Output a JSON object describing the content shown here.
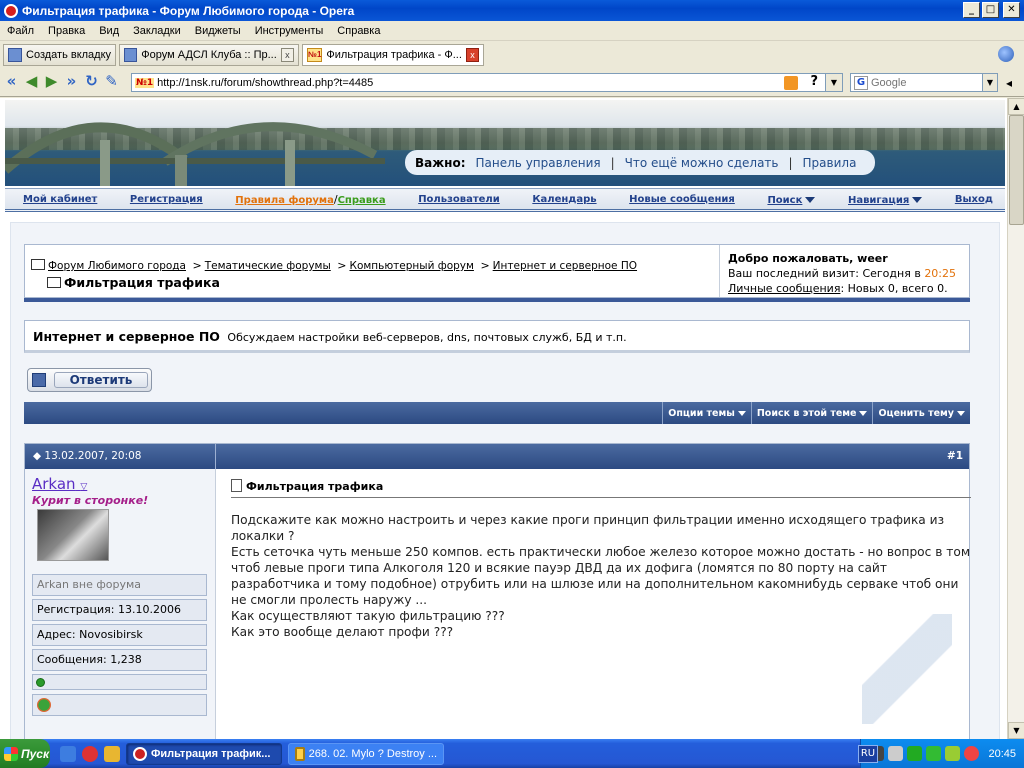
{
  "window": {
    "title": "Фильтрация трафика - Форум Любимого города - Opera",
    "controls": [
      "_",
      "□",
      "✕"
    ]
  },
  "menu": [
    "Файл",
    "Правка",
    "Вид",
    "Закладки",
    "Виджеты",
    "Инструменты",
    "Справка"
  ],
  "tabs": [
    {
      "label": "Создать вкладку"
    },
    {
      "label": "Форум АДСЛ Клуба :: Пр...",
      "close": "x"
    },
    {
      "label": "Фильтрация трафика - Ф...",
      "close": "x",
      "badge": "№1"
    }
  ],
  "address": {
    "badge": "№1",
    "url": "http://1nsk.ru/forum/showthread.php?t=4485",
    "help": "?",
    "search_placeholder": "Google",
    "search_badge": "G"
  },
  "forum": {
    "important": {
      "label": "Важно:",
      "links": [
        "Панель управления",
        "Что ещё можно сделать",
        "Правила"
      ]
    },
    "nav": {
      "cabinet": "Мой кабинет",
      "register": "Регистрация",
      "rules": "Правила форума",
      "slash": "/",
      "help": "Справка",
      "users": "Пользователи",
      "calendar": "Календарь",
      "new_posts": "Новые сообщения",
      "search": "Поиск",
      "navigation": "Навигация",
      "logout": "Выход"
    },
    "breadcrumb": {
      "items": [
        "Форум Любимого города",
        "Тематические форумы",
        "Компьютерный форум",
        "Интернет и серверное ПО"
      ],
      "separator": ">",
      "current": "Фильтрация трафика"
    },
    "welcome": {
      "greeting": "Добро пожаловать, weer",
      "last_visit_label": "Ваш последний визит: Сегодня в",
      "last_visit_time": "20:25",
      "pm_link": "Личные сообщения",
      "pm_status": ": Новых 0, всего 0."
    },
    "forum_desc": {
      "name": "Интернет и серверное ПО",
      "desc": "Обсуждаем настройки веб-серверов, dns, почтовых служб, БД и т.п."
    },
    "reply_button": "Ответить",
    "thread_tools": [
      "Опции темы",
      "Поиск в этой теме",
      "Оценить тему"
    ],
    "post": {
      "date": "13.02.2007, 20:08",
      "number": "#1",
      "author": "Arkan",
      "user_title": "Курит в сторонке!",
      "status": "Arkan вне форума",
      "registration": "Регистрация: 13.10.2006",
      "address": "Адрес: Novosibirsk",
      "messages": "Сообщения: 1,238",
      "title": "Фильтрация трафика",
      "text": "Подскажите как можно настроить и через какие проги принцип фильтрации именно исходящего трафика из локалки ?\nЕсть сеточка чуть меньше 250 компов. есть практически любое железо которое можно достать - но вопрос в том чтоб левые проги типа Алкоголя 120 и всякие пауэр ДВД да их дофига (ломятся по 80 порту на сайт разработчика и тому подобное) отрубить или на шлюзе или на дополнительном какомнибудь серваке чтоб они не смогли пролесть наружу ...\nКак осуществляют такую фильтрацию ???\nКак это вообще делают профи ???"
    }
  },
  "taskbar": {
    "start": "Пуск",
    "items": [
      "Фильтрация трафик...",
      "268. 02. Mylo ? Destroy ..."
    ],
    "lang": "RU",
    "clock": "20:45"
  }
}
